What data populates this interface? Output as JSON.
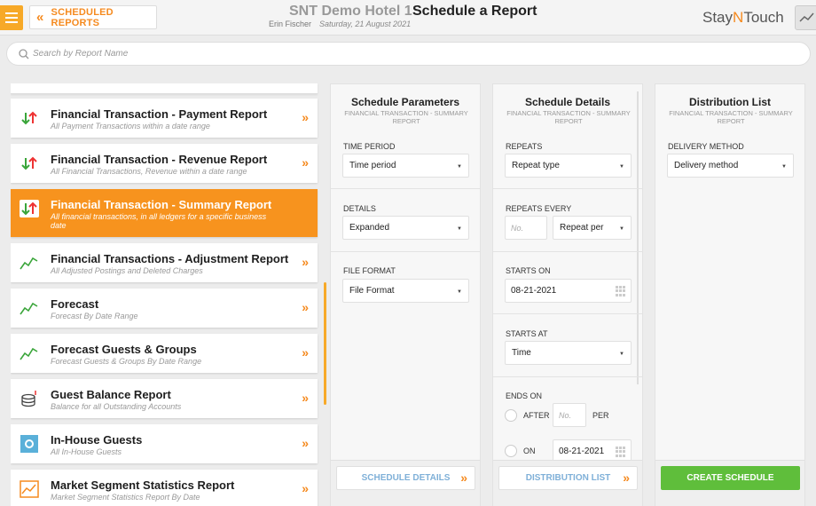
{
  "header": {
    "back_label": "SCHEDULED REPORTS",
    "hotel_name": "SNT Demo Hotel 1",
    "page_title": "Schedule a Report",
    "user_name": "Erin Fischer",
    "date": "Saturday, 21 August 2021",
    "logo_pre": "Stay",
    "logo_mid": "N",
    "logo_post": "Touch"
  },
  "search": {
    "placeholder": "Search by Report Name"
  },
  "reports": [
    {
      "title": "Financial Transaction - Payment Report",
      "desc": "All Payment Transactions within a date range",
      "icon": "arrows-updown-icon"
    },
    {
      "title": "Financial Transaction - Revenue Report",
      "desc": "All Financial Transactions, Revenue within a date range",
      "icon": "arrows-updown-icon"
    },
    {
      "title": "Financial Transaction - Summary Report",
      "desc": "All financial transactions, in all ledgers for a specific business date",
      "icon": "arrows-updown-icon",
      "active": true
    },
    {
      "title": "Financial Transactions - Adjustment Report",
      "desc": "All Adjusted Postings and Deleted Charges",
      "icon": "trend-line-icon"
    },
    {
      "title": "Forecast",
      "desc": "Forecast By Date Range",
      "icon": "trend-line-icon"
    },
    {
      "title": "Forecast Guests & Groups",
      "desc": "Forecast Guests & Groups By Date Range",
      "icon": "trend-line-icon"
    },
    {
      "title": "Guest Balance Report",
      "desc": "Balance for all Outstanding Accounts",
      "icon": "coins-icon"
    },
    {
      "title": "In-House Guests",
      "desc": "All In-House Guests",
      "icon": "in-house-icon"
    },
    {
      "title": "Market Segment Statistics Report",
      "desc": "Market Segment Statistics Report By Date",
      "icon": "chart-icon"
    }
  ],
  "schedule_params": {
    "title": "Schedule Parameters",
    "subtitle": "FINANCIAL TRANSACTION - SUMMARY REPORT",
    "time_period_label": "TIME PERIOD",
    "time_period_value": "Time period",
    "details_label": "DETAILS",
    "details_value": "Expanded",
    "file_format_label": "FILE FORMAT",
    "file_format_value": "File Format",
    "footer_button": "SCHEDULE DETAILS"
  },
  "schedule_details": {
    "title": "Schedule Details",
    "subtitle": "FINANCIAL TRANSACTION - SUMMARY REPORT",
    "repeats_label": "REPEATS",
    "repeats_value": "Repeat type",
    "repeats_every_label": "REPEATS EVERY",
    "repeats_every_placeholder": "No.",
    "repeat_per_value": "Repeat per",
    "starts_on_label": "STARTS ON",
    "starts_on_value": "08-21-2021",
    "starts_at_label": "STARTS AT",
    "starts_at_value": "Time",
    "ends_on_label": "ENDS ON",
    "after_label": "AFTER",
    "after_placeholder": "No.",
    "per_label": "PER",
    "on_label": "ON",
    "ends_on_date": "08-21-2021",
    "footer_button": "DISTRIBUTION LIST"
  },
  "distribution": {
    "title": "Distribution List",
    "subtitle": "FINANCIAL TRANSACTION - SUMMARY REPORT",
    "delivery_label": "DELIVERY METHOD",
    "delivery_value": "Delivery method",
    "footer_button": "CREATE SCHEDULE"
  },
  "colors": {
    "accent": "#f7931e",
    "green": "#5fbe3b",
    "link_blue": "#7fb0d8"
  }
}
